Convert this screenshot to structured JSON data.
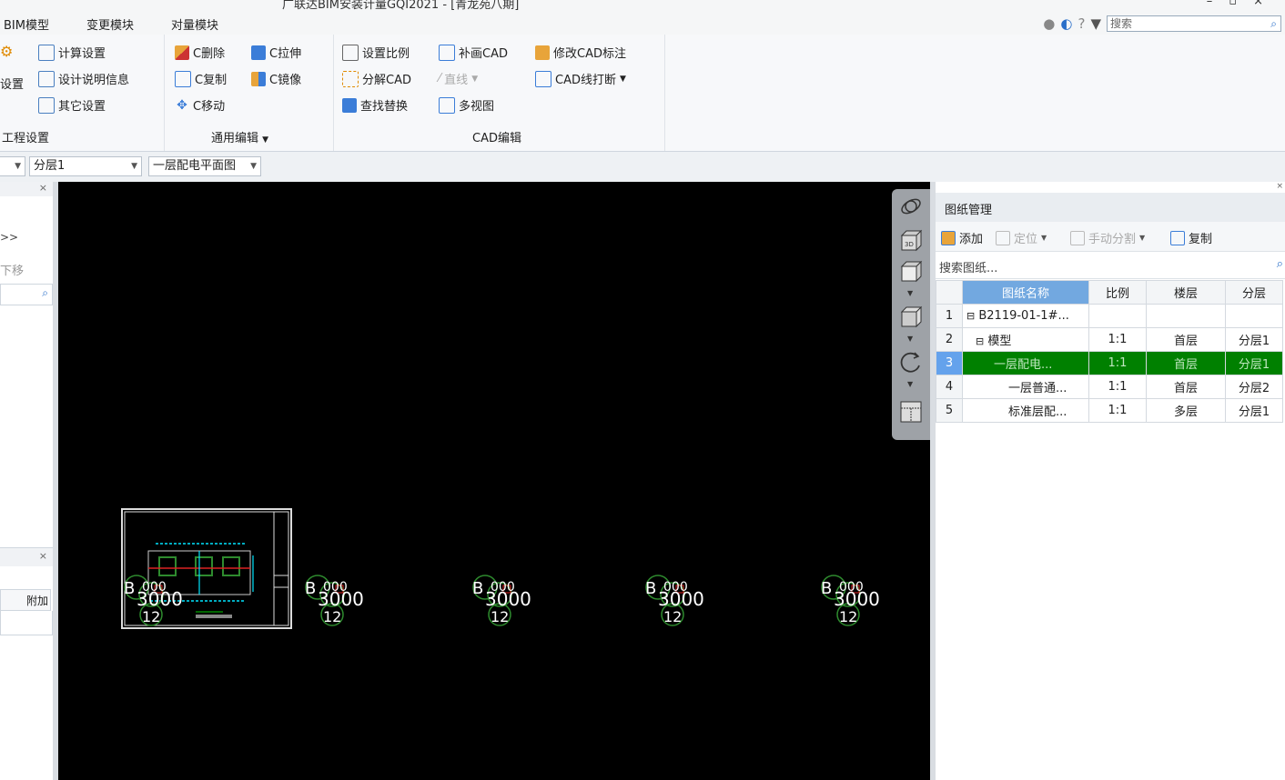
{
  "window": {
    "title": "广联达BIM安装计量GQI2021 - [青龙苑八期]"
  },
  "menu": [
    "BIM模型",
    "变更模块",
    "对量模块"
  ],
  "topright": {
    "search_placeholder": "搜索",
    "help": "?"
  },
  "ribbon": {
    "project_settings": {
      "big_label": "设置",
      "tools": [
        "计算设置",
        "设计说明信息",
        "其它设置"
      ],
      "label": "工程设置"
    },
    "common_edit": {
      "tools": [
        "C删除",
        "C拉伸",
        "C复制",
        "C镜像",
        "C移动"
      ],
      "label": "通用编辑"
    },
    "cad_edit": {
      "tools": [
        "设置比例",
        "补画CAD",
        "修改CAD标注",
        "分解CAD",
        "直线",
        "CAD线打断",
        "查找替换",
        "多视图"
      ],
      "label": "CAD编辑"
    }
  },
  "layerbar": {
    "sublayer": "分层1",
    "drawing": "一层配电平面图"
  },
  "leftpanel": {
    "nav": ">>",
    "shift": "下移",
    "extra_col": "附加"
  },
  "canvas": {
    "marker_lines": [
      "B",
      "000",
      "3000",
      "12"
    ]
  },
  "drawing_manager": {
    "title": "图纸管理",
    "toolbar": {
      "add": "添加",
      "locate": "定位",
      "manual_split": "手动分割",
      "copy": "复制"
    },
    "search_placeholder": "搜索图纸...",
    "columns": [
      "图纸名称",
      "比例",
      "楼层",
      "分层"
    ],
    "rows": [
      {
        "num": "1",
        "name": "B2119-01-1#...",
        "scale": "",
        "floor": "",
        "layer": ""
      },
      {
        "num": "2",
        "name": "模型",
        "scale": "1:1",
        "floor": "首层",
        "layer": "分层1"
      },
      {
        "num": "3",
        "name": "一层配电...",
        "scale": "1:1",
        "floor": "首层",
        "layer": "分层1"
      },
      {
        "num": "4",
        "name": "一层普通...",
        "scale": "1:1",
        "floor": "首层",
        "layer": "分层2"
      },
      {
        "num": "5",
        "name": "标准层配...",
        "scale": "1:1",
        "floor": "多层",
        "layer": "分层1"
      }
    ],
    "active_row": 3
  },
  "colors": {
    "accent": "#2a6fc9",
    "canvas_bg": "#000000",
    "active_row": "#008000",
    "cad_cyan": "#00e5ff",
    "cad_green": "#2e8b2e"
  }
}
